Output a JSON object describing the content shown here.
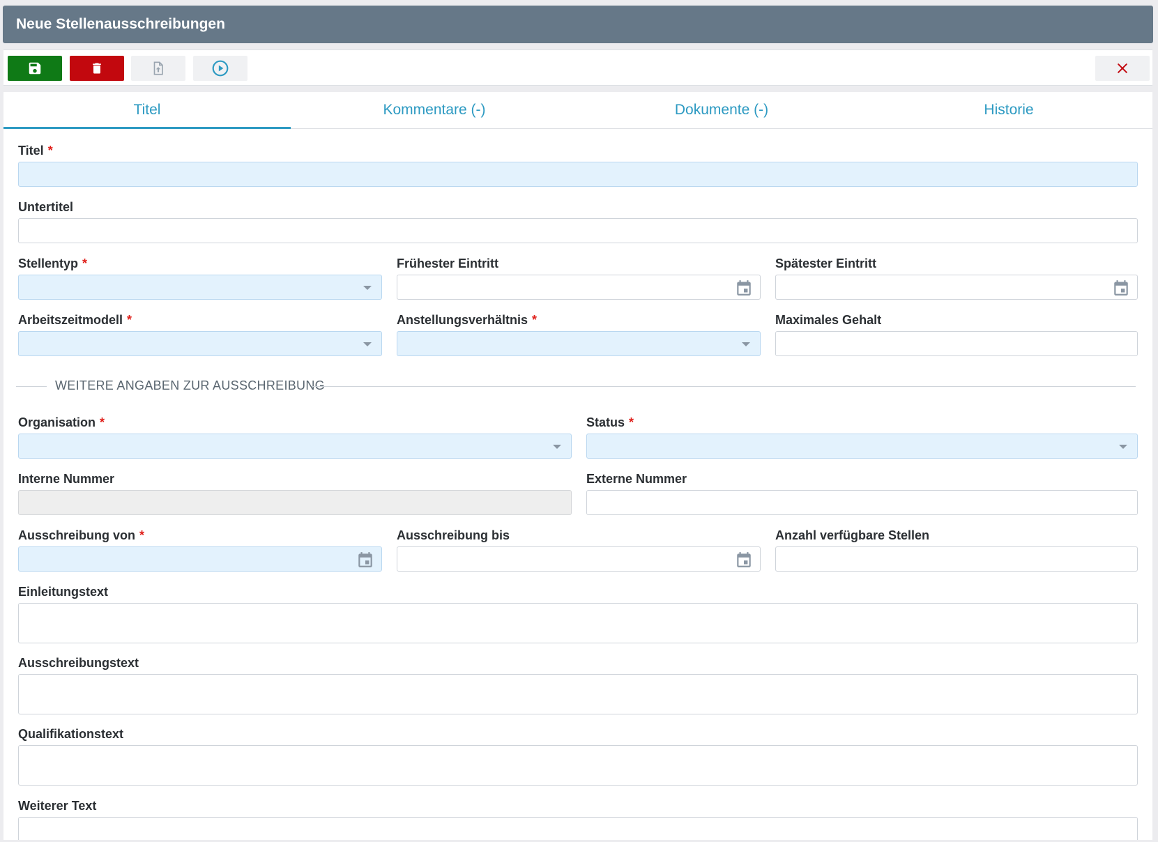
{
  "window": {
    "title": "Neue Stellenausschreibungen"
  },
  "toolbar": {
    "save_icon": "save-icon",
    "delete_icon": "trash-icon",
    "upload_icon": "file-upload-icon",
    "play_icon": "play-circle-icon",
    "close_icon": "close-icon",
    "colors": {
      "save": "#0f7a16",
      "delete": "#c2080e",
      "accent": "#2d9ac2"
    }
  },
  "tabs": [
    {
      "label": "Titel",
      "active": true
    },
    {
      "label": "Kommentare (-)",
      "active": false
    },
    {
      "label": "Dokumente (-)",
      "active": false
    },
    {
      "label": "Historie",
      "active": false
    }
  ],
  "form": {
    "required_marker": "*",
    "titel": {
      "label": "Titel",
      "value": ""
    },
    "untertitel": {
      "label": "Untertitel",
      "value": ""
    },
    "stellentyp": {
      "label": "Stellentyp",
      "value": ""
    },
    "fruehester_eintritt": {
      "label": "Frühester Eintritt",
      "value": ""
    },
    "spaetester_eintritt": {
      "label": "Spätester Eintritt",
      "value": ""
    },
    "arbeitszeitmodell": {
      "label": "Arbeitszeitmodell",
      "value": ""
    },
    "anstellungsverhaeltnis": {
      "label": "Anstellungsverhältnis",
      "value": ""
    },
    "maximales_gehalt": {
      "label": "Maximales Gehalt",
      "value": ""
    },
    "section_title": "WEITERE ANGABEN ZUR AUSSCHREIBUNG",
    "organisation": {
      "label": "Organisation",
      "value": ""
    },
    "status": {
      "label": "Status",
      "value": ""
    },
    "interne_nummer": {
      "label": "Interne Nummer",
      "value": ""
    },
    "externe_nummer": {
      "label": "Externe Nummer",
      "value": ""
    },
    "ausschreibung_von": {
      "label": "Ausschreibung von",
      "value": ""
    },
    "ausschreibung_bis": {
      "label": "Ausschreibung bis",
      "value": ""
    },
    "anzahl_stellen": {
      "label": "Anzahl verfügbare Stellen",
      "value": ""
    },
    "einleitungstext": {
      "label": "Einleitungstext",
      "value": ""
    },
    "ausschreibungstext": {
      "label": "Ausschreibungstext",
      "value": ""
    },
    "qualifikationstext": {
      "label": "Qualifikationstext",
      "value": ""
    },
    "weiterer_text": {
      "label": "Weiterer Text",
      "value": ""
    }
  }
}
